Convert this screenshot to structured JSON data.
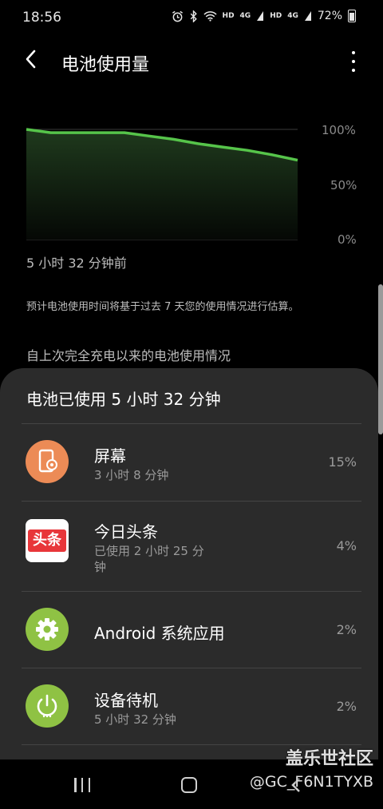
{
  "status_bar": {
    "time": "18:56",
    "icons": [
      "alarm-icon",
      "bluetooth-icon",
      "wifi-icon",
      "signal-icon",
      "signal-icon",
      "battery-icon"
    ],
    "hd1": "HD",
    "net1": "4G",
    "hd2": "HD",
    "net2": "4G",
    "battery_percent": "72%"
  },
  "header": {
    "title": "电池使用量"
  },
  "chart_data": {
    "type": "area",
    "x": [
      0,
      0.5,
      1,
      1.5,
      2,
      2.5,
      3,
      3.5,
      4,
      4.5,
      5,
      5.53
    ],
    "values": [
      100,
      97,
      97,
      97,
      97,
      94,
      91,
      87,
      84,
      81,
      77,
      72
    ],
    "y_tick_labels": [
      "100%",
      "50%",
      "0%"
    ],
    "ylim": [
      0,
      100
    ],
    "line_color": "#56c44a",
    "xlabel": "5 小时 32 分钟前"
  },
  "main": {
    "estimate_note": "预计电池使用时间将基于过去 7 天您的使用情况进行估算。",
    "section_title": "自上次完全充电以来的电池使用情况"
  },
  "sheet": {
    "title": "电池已使用 5 小时 32 分钟",
    "apps": [
      {
        "name": "屏幕",
        "sub": "3 小时 8 分钟",
        "percent": "15%",
        "icon": "screen-icon",
        "icon_color": "#ec8b56"
      },
      {
        "name": "今日头条",
        "sub": "已使用 2 小时 25 分\n钟",
        "percent": "4%",
        "icon": "toutiao-icon",
        "icon_label": "头条",
        "icon_color": "#e8363a"
      },
      {
        "name": "Android 系统应用",
        "sub": "",
        "percent": "2%",
        "icon": "gear-icon",
        "icon_color": "#8fc244"
      },
      {
        "name": "设备待机",
        "sub": "5 小时 32 分钟",
        "percent": "2%",
        "icon": "power-icon",
        "icon_color": "#8fc244"
      }
    ]
  },
  "watermark": {
    "brand": "盖乐世社区",
    "user": "@GC_F6N1TYXB"
  }
}
